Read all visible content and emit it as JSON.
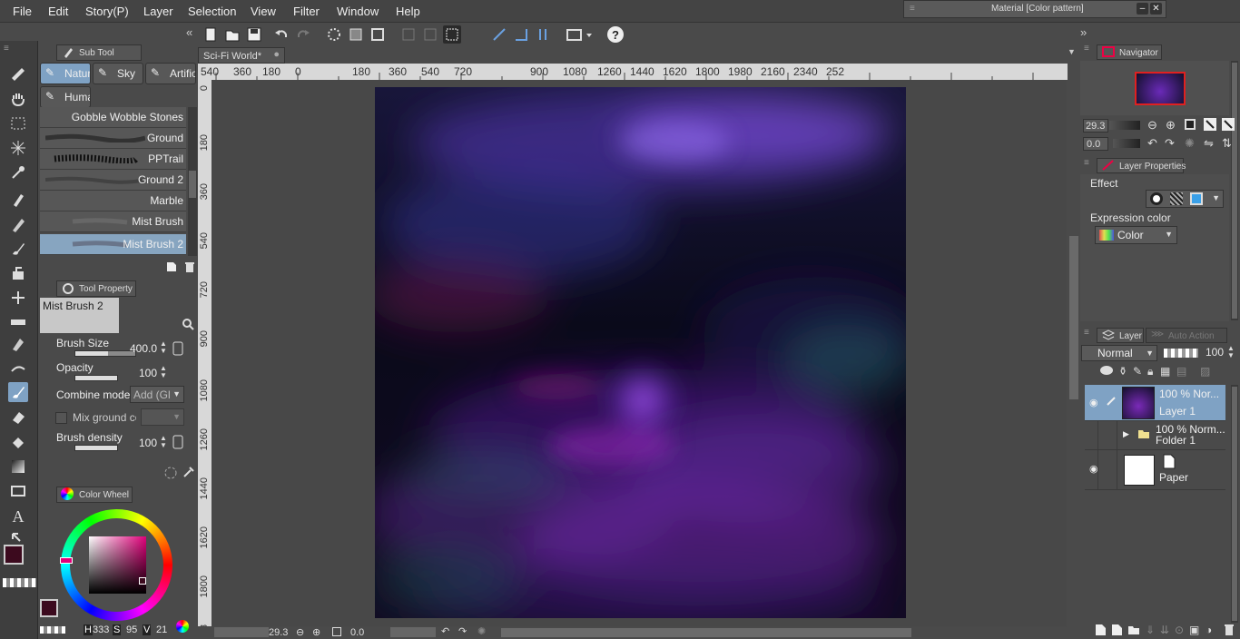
{
  "menu": [
    "File",
    "Edit",
    "Story(P)",
    "Layer",
    "Selection",
    "View",
    "Filter",
    "Window",
    "Help"
  ],
  "material_window": {
    "title": "Material [Color pattern]"
  },
  "sub_tool": {
    "tab_label": "Sub Tool",
    "groups": [
      "Natur",
      "Sky",
      "Artific",
      "Huma"
    ],
    "brushes": [
      "Gobble Wobble Stones",
      "Ground",
      "PPTrail",
      "Ground 2",
      "Marble",
      "Mist Brush",
      "Mist Brush 2"
    ],
    "selected_brush": "Mist Brush 2"
  },
  "tool_property": {
    "tab_label": "Tool Property",
    "preset_name": "Mist Brush 2",
    "brush_size": {
      "label": "Brush Size",
      "value": "400.0",
      "level": 0.55
    },
    "opacity": {
      "label": "Opacity",
      "value": "100",
      "level": 1.0
    },
    "combine_mode": {
      "label": "Combine mode",
      "value": "Add (Gl"
    },
    "mix_ground": {
      "label": "Mix ground co",
      "checked": false
    },
    "brush_density": {
      "label": "Brush density",
      "value": "100",
      "level": 1.0
    }
  },
  "color_wheel": {
    "tab_label": "Color Wheel",
    "h_label": "H",
    "h": "333",
    "s_label": "S",
    "s": "95",
    "v_label": "V",
    "v": "21",
    "main_color": "#3c0a1e"
  },
  "document": {
    "tab": "Sci-Fi World*"
  },
  "rulers": {
    "top": [
      "540",
      "360",
      "180",
      "0",
      "180",
      "360",
      "540",
      "720",
      "900",
      "1080",
      "1260",
      "1440",
      "1620",
      "1800",
      "1980",
      "2160",
      "2340",
      "252"
    ],
    "left": [
      "0",
      "180",
      "360",
      "540",
      "720",
      "900",
      "1080",
      "1260",
      "1440",
      "1620",
      "1800",
      "198"
    ]
  },
  "status": {
    "zoom": "29.3",
    "angle": "0.0"
  },
  "navigator": {
    "tab_label": "Navigator",
    "zoom": "29.3",
    "angle": "0.0"
  },
  "layer_properties": {
    "tab_label": "Layer Properties",
    "effect_label": "Effect",
    "expression_label": "Expression color",
    "expression_value": "Color"
  },
  "layers": {
    "tab_label": "Layer",
    "tab2_label": "Auto Action",
    "blend_mode": "Normal",
    "opacity": "100",
    "items": [
      {
        "top": "100 %  Nor...",
        "name": "Layer 1"
      },
      {
        "top": "100 %  Norm...",
        "name": "Folder 1"
      },
      {
        "top": "",
        "name": "Paper"
      }
    ]
  },
  "colors": {
    "accent": "#7fa2c4",
    "panel": "#4e4e4e",
    "dark": "#3e3e3e"
  }
}
